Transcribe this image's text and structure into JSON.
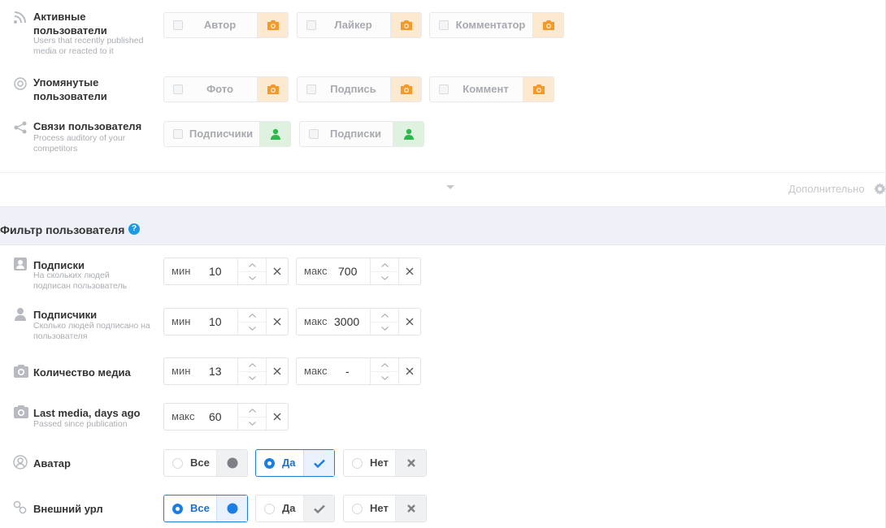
{
  "colors": {
    "accent": "#1a7ee6",
    "orange": "#f49a2a",
    "green": "#2cb84a",
    "muted": "#a6aab0"
  },
  "type_rows": [
    {
      "title": "Активные пользователи",
      "subtitle": "Users that recently published media or reacted to it",
      "icon": "rss-icon",
      "chips": [
        "Автор",
        "Лайкер",
        "Комментатор"
      ]
    },
    {
      "title": "Упомянутые пользователи",
      "subtitle": "",
      "icon": "at-icon",
      "chips": [
        "Фото",
        "Подпись",
        "Коммент"
      ]
    },
    {
      "title": "Связи пользователя",
      "subtitle": "Process auditory of your competitors",
      "icon": "share-icon",
      "chips": [
        "Подписчики",
        "Подписки"
      ]
    }
  ],
  "more": {
    "label": "Дополнительно"
  },
  "filter": {
    "title": "Фильтр пользователя",
    "help": "?",
    "rows": [
      {
        "title": "Подписки",
        "subtitle": "На скольких людей подписан пользователь",
        "min_label": "мин",
        "min": "10",
        "max_label": "макс",
        "max": "700"
      },
      {
        "title": "Подписчики",
        "subtitle": "Сколько людей подписано на пользователя",
        "min_label": "мин",
        "min": "10",
        "max_label": "макс",
        "max": "3000"
      },
      {
        "title": "Количество медиа",
        "subtitle": "",
        "min_label": "мин",
        "min": "13",
        "max_label": "макс",
        "max": "-"
      },
      {
        "title": "Last media, days ago",
        "subtitle": "Passed since publication",
        "max_label": "макс",
        "max": "60"
      }
    ],
    "avatar": {
      "title": "Аватар",
      "options": [
        "Все",
        "Да",
        "Нет"
      ],
      "selected": "Да"
    },
    "url": {
      "title": "Внешний урл",
      "options": [
        "Все",
        "Да",
        "Нет"
      ],
      "selected": "Все"
    }
  }
}
